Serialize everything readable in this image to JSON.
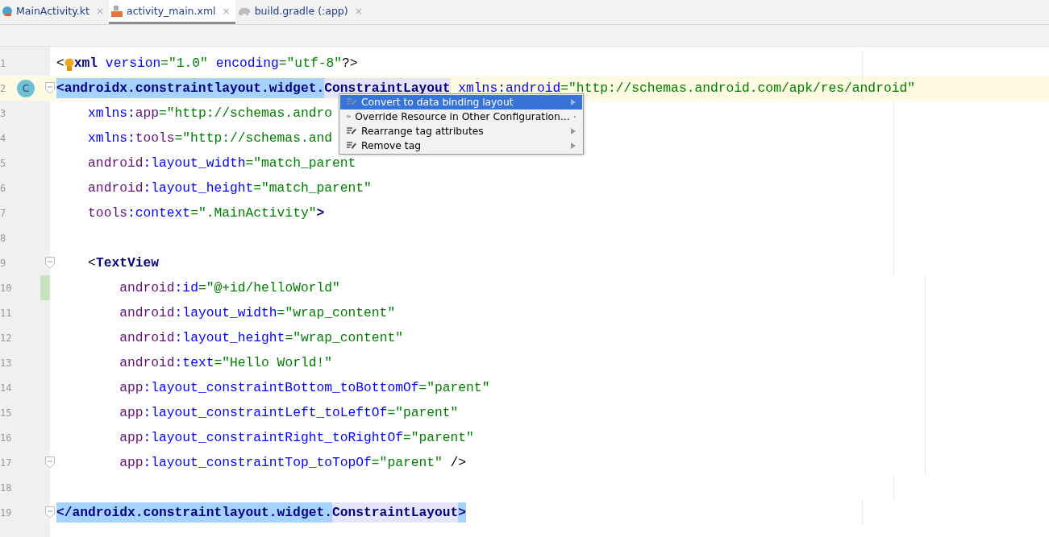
{
  "tabs": [
    {
      "label": "MainActivity.kt",
      "selected": false,
      "kind": "kotlin",
      "close": "×"
    },
    {
      "label": "activity_main.xml",
      "selected": true,
      "kind": "xml",
      "close": "×"
    },
    {
      "label": "build.gradle (:app)",
      "selected": false,
      "kind": "gradle",
      "close": "×"
    }
  ],
  "lines": [
    {
      "number": "1",
      "current": false,
      "fold": false,
      "changed": false,
      "tokens": [
        {
          "kind": "punct",
          "text": "<"
        },
        {
          "kind": "bulb"
        },
        {
          "kind": "tag",
          "text": "xml"
        },
        {
          "kind": "attr",
          "text": " version"
        },
        {
          "kind": "value",
          "text": "=\"1.0\""
        },
        {
          "kind": "attr",
          "text": " encoding"
        },
        {
          "kind": "value",
          "text": "=\"utf-8\""
        },
        {
          "kind": "punct",
          "text": "?>"
        }
      ]
    },
    {
      "number": "2",
      "current": true,
      "fold": true,
      "changed": false,
      "badge": "C",
      "tokens": [
        {
          "kind": "tag",
          "text": "<androidx.constraintlayout.widget.",
          "selected": true,
          "matched": false
        },
        {
          "kind": "tag",
          "text": "ConstraintLayout",
          "selected": false,
          "matched": true
        },
        {
          "kind": "attr",
          "text": " xmlns:android",
          "selected": false,
          "matched": false
        },
        {
          "kind": "value",
          "text": "=\"http://schemas.android.com/apk/res/android\"",
          "selected": false,
          "matched": false
        }
      ],
      "children": [
        {
          "number": "3",
          "current": false,
          "fold": false,
          "changed": false,
          "tokens": [
            {
              "kind": "attr",
              "text": "xmlns:"
            },
            {
              "kind": "ns",
              "text": "app"
            },
            {
              "kind": "value",
              "text": "=\"http://schemas.andro"
            }
          ]
        },
        {
          "number": "4",
          "current": false,
          "fold": false,
          "changed": false,
          "tokens": [
            {
              "kind": "attr",
              "text": "xmlns:"
            },
            {
              "kind": "ns",
              "text": "tools"
            },
            {
              "kind": "value",
              "text": "=\"http://schemas.and"
            }
          ]
        },
        {
          "number": "5",
          "current": false,
          "fold": false,
          "changed": false,
          "tokens": [
            {
              "kind": "ns",
              "text": "android"
            },
            {
              "kind": "attr",
              "text": ":layout_width"
            },
            {
              "kind": "value",
              "text": "=\"match_parent"
            }
          ]
        },
        {
          "number": "6",
          "current": false,
          "fold": false,
          "changed": false,
          "tokens": [
            {
              "kind": "ns",
              "text": "android"
            },
            {
              "kind": "attr",
              "text": ":layout_height"
            },
            {
              "kind": "value",
              "text": "=\"match_parent\""
            }
          ]
        },
        {
          "number": "7",
          "current": false,
          "fold": false,
          "changed": false,
          "tokens": [
            {
              "kind": "ns",
              "text": "tools"
            },
            {
              "kind": "attr",
              "text": ":context"
            },
            {
              "kind": "value",
              "text": "=\".MainActivity\""
            },
            {
              "kind": "tag",
              "text": ">"
            }
          ]
        },
        {
          "number": "8",
          "current": false,
          "fold": false,
          "changed": false
        },
        {
          "number": "9",
          "current": false,
          "fold": true,
          "changed": false,
          "tokens": [
            {
              "kind": "punct",
              "text": "<"
            },
            {
              "kind": "tag",
              "text": "TextView"
            }
          ],
          "children": [
            {
              "number": "10",
              "current": false,
              "fold": false,
              "changed": true,
              "tokens": [
                {
                  "kind": "ns",
                  "text": "android"
                },
                {
                  "kind": "attr",
                  "text": ":id"
                },
                {
                  "kind": "value",
                  "text": "=\"@+id/helloWorld\""
                }
              ]
            },
            {
              "number": "11",
              "current": false,
              "fold": false,
              "changed": false,
              "tokens": [
                {
                  "kind": "ns",
                  "text": "android"
                },
                {
                  "kind": "attr",
                  "text": ":layout_width"
                },
                {
                  "kind": "value",
                  "text": "=\"wrap_content\""
                }
              ]
            },
            {
              "number": "12",
              "current": false,
              "fold": false,
              "changed": false,
              "tokens": [
                {
                  "kind": "ns",
                  "text": "android"
                },
                {
                  "kind": "attr",
                  "text": ":layout_height"
                },
                {
                  "kind": "value",
                  "text": "=\"wrap_content\""
                }
              ]
            },
            {
              "number": "13",
              "current": false,
              "fold": false,
              "changed": false,
              "tokens": [
                {
                  "kind": "ns",
                  "text": "android"
                },
                {
                  "kind": "attr",
                  "text": ":text"
                },
                {
                  "kind": "value",
                  "text": "=\"Hello World!\""
                }
              ]
            },
            {
              "number": "14",
              "current": false,
              "fold": false,
              "changed": false,
              "tokens": [
                {
                  "kind": "ns",
                  "text": "app"
                },
                {
                  "kind": "attr",
                  "text": ":layout_constraintBottom_toBottomOf"
                },
                {
                  "kind": "value",
                  "text": "=\"parent\""
                }
              ]
            },
            {
              "number": "15",
              "current": false,
              "fold": false,
              "changed": false,
              "tokens": [
                {
                  "kind": "ns",
                  "text": "app"
                },
                {
                  "kind": "attr",
                  "text": ":layout_constraintLeft_toLeftOf"
                },
                {
                  "kind": "value",
                  "text": "=\"parent\""
                }
              ]
            },
            {
              "number": "16",
              "current": false,
              "fold": false,
              "changed": false,
              "tokens": [
                {
                  "kind": "ns",
                  "text": "app"
                },
                {
                  "kind": "attr",
                  "text": ":layout_constraintRight_toRightOf"
                },
                {
                  "kind": "value",
                  "text": "=\"parent\""
                }
              ]
            },
            {
              "number": "17",
              "current": false,
              "fold": true,
              "changed": false,
              "tokens": [
                {
                  "kind": "ns",
                  "text": "app"
                },
                {
                  "kind": "attr",
                  "text": ":layout_constraintTop_toTopOf"
                },
                {
                  "kind": "value",
                  "text": "=\"parent\""
                },
                {
                  "kind": "punct",
                  "text": " />"
                }
              ]
            }
          ]
        },
        {
          "number": "18",
          "current": false,
          "fold": false,
          "changed": false
        }
      ]
    },
    {
      "number": "19",
      "current": false,
      "fold": true,
      "changed": false,
      "tokens": [
        {
          "kind": "tag",
          "text": "</androidx.constraintlayout.widget.",
          "selected": true,
          "matched": false
        },
        {
          "kind": "tag",
          "text": "ConstraintLayout",
          "selected": false,
          "matched": true
        },
        {
          "kind": "tag",
          "text": ">",
          "selected": true,
          "matched": false
        }
      ]
    }
  ],
  "menu": [
    {
      "label": "Convert to data binding layout",
      "selected": true
    },
    {
      "label": "Override Resource in Other Configuration...",
      "selected": false
    },
    {
      "label": "Rearrange tag attributes",
      "selected": false
    },
    {
      "label": "Remove tag",
      "selected": false
    }
  ]
}
